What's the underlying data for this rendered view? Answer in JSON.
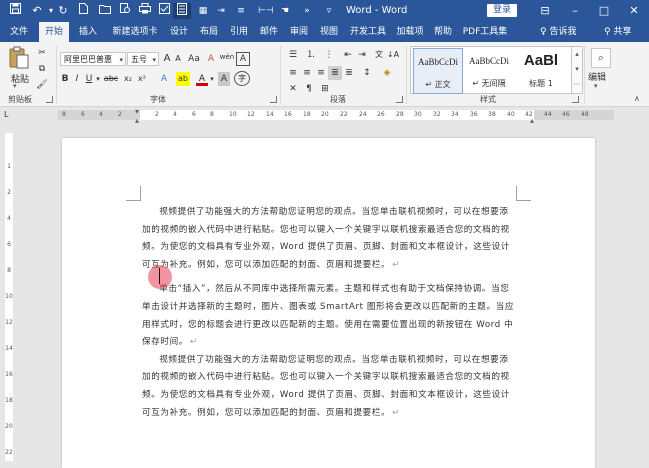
{
  "quick_access": {
    "icons": [
      "save-icon",
      "undo-icon",
      "redo-icon",
      "new-doc-icon",
      "open-icon",
      "print-preview-icon",
      "print-icon",
      "checkbox-icon",
      "outline-icon",
      "grid-icon",
      "indent-icon",
      "line-spacing-icon",
      "customize-icon"
    ]
  },
  "window": {
    "title": "Word  -  Word",
    "login_label": "登录",
    "controls": [
      "⊟",
      "–",
      "□",
      "✕"
    ]
  },
  "tabs": [
    {
      "label": "文件",
      "active": false
    },
    {
      "label": "开始",
      "active": true
    },
    {
      "label": "插入",
      "active": false
    },
    {
      "label": "新建选项卡",
      "active": false
    },
    {
      "label": "设计",
      "active": false
    },
    {
      "label": "布局",
      "active": false
    },
    {
      "label": "引用",
      "active": false
    },
    {
      "label": "邮件",
      "active": false
    },
    {
      "label": "审阅",
      "active": false
    },
    {
      "label": "视图",
      "active": false
    },
    {
      "label": "开发工具",
      "active": false
    },
    {
      "label": "加载项",
      "active": false
    },
    {
      "label": "帮助",
      "active": false
    },
    {
      "label": "PDF工具集",
      "active": false
    }
  ],
  "tell_me": "告诉我",
  "share": "共享",
  "ribbon": {
    "clipboard": {
      "paste_label": "粘贴",
      "group_label": "剪贴板"
    },
    "font": {
      "font_name": "阿里巴巴普惠",
      "font_size": "五号",
      "size_up": "A",
      "size_down": "A",
      "case_label": "Aa",
      "clear_label": "A",
      "wen_label": "wén",
      "char_box_label": "A",
      "bold": "B",
      "italic": "I",
      "underline": "U",
      "strike": "abc",
      "subscript": "x₂",
      "superscript": "x²",
      "effects": "A",
      "highlight": "ab",
      "font_color": "A",
      "shade": "A",
      "circle": "字",
      "group_label": "字体"
    },
    "paragraph": {
      "group_label": "段落"
    },
    "styles": {
      "items": [
        {
          "sample": "AaBbCcDi",
          "name": "↵ 正文"
        },
        {
          "sample": "AaBbCcDi",
          "name": "↵ 无间隔"
        },
        {
          "sample": "AaBl",
          "name": "标题 1"
        }
      ],
      "group_label": "样式"
    },
    "editing": {
      "label": "编辑"
    }
  },
  "ruler": {
    "numbers": [
      "8",
      "6",
      "4",
      "2",
      "",
      "2",
      "4",
      "6",
      "8",
      "10",
      "12",
      "14",
      "16",
      "18",
      "20",
      "22",
      "24",
      "26",
      "28",
      "30",
      "32",
      "34",
      "36",
      "38",
      "40",
      "42",
      "44",
      "46",
      "48"
    ]
  },
  "vruler": {
    "numbers": [
      "1",
      "2",
      "4",
      "6",
      "8",
      "10",
      "12",
      "14",
      "16",
      "18",
      "20",
      "22"
    ]
  },
  "document": {
    "paragraphs": [
      "视频提供了功能强大的方法帮助您证明您的观点。当您单击联机视频时，可以在想要添加的视频的嵌入代码中进行粘贴。您也可以键入一个关键字以联机搜索最适合您的文档的视频。为使您的文档具有专业外观，Word 提供了页眉、页脚、封面和文本框设计，这些设计可互为补充。例如，您可以添加匹配的封面、页眉和提要栏。",
      "单击“插入”，然后从不同库中选择所需元素。主题和样式也有助于文档保持协调。当您单击设计并选择新的主题时，图片、图表或 SmartArt 图形将会更改以匹配新的主题。当应用样式时，您的标题会进行更改以匹配新的主题。使用在需要位置出现的新按钮在 Word 中保存时间。",
      "视频提供了功能强大的方法帮助您证明您的观点。当您单击联机视频时，可以在想要添加的视频的嵌入代码中进行粘贴。您也可以键入一个关键字以联机搜索最适合您的文档的视频。为使您的文档具有专业外观，Word 提供了页眉、页脚、封面和文本框设计，这些设计可互为补充。例如，您可以添加匹配的封面、页眉和提要栏。"
    ],
    "paragraph_mark": "↵"
  }
}
